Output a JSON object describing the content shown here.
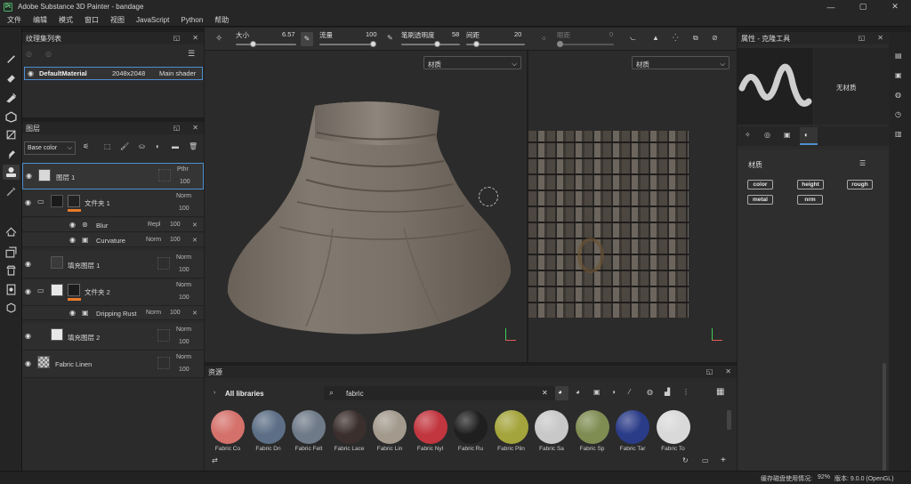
{
  "window": {
    "title": "Adobe Substance 3D Painter - bandage",
    "minimize": "—",
    "maximize": "▢",
    "close": "✕"
  },
  "menu": [
    "文件",
    "编辑",
    "模式",
    "窗口",
    "视图",
    "JavaScript",
    "Python",
    "帮助"
  ],
  "texture_set_list": {
    "title": "纹理集列表",
    "row": {
      "name": "DefaultMaterial",
      "resolution": "2048x2048",
      "shader": "Main shader"
    }
  },
  "layers": {
    "title": "图层",
    "channel": "Base color",
    "items": [
      {
        "name": "图层 1",
        "blend": "Pthr",
        "opacity": "100"
      },
      {
        "name": "文件夹 1",
        "blend": "Norm",
        "opacity": "100"
      },
      {
        "name": "Blur",
        "blend": "Repl",
        "opacity": "100"
      },
      {
        "name": "Curvature",
        "blend": "Norm",
        "opacity": "100"
      },
      {
        "name": "填充图层 1",
        "blend": "Norm",
        "opacity": "100"
      },
      {
        "name": "文件夹 2",
        "blend": "Norm",
        "opacity": "100"
      },
      {
        "name": "Dripping Rust",
        "blend": "Norm",
        "opacity": "100"
      },
      {
        "name": "填充图层 2",
        "blend": "Norm",
        "opacity": "100"
      },
      {
        "name": "Fabric Linen",
        "blend": "Norm",
        "opacity": "100"
      }
    ]
  },
  "context_toolbar": {
    "size_label": "大小",
    "size_value": "6.57",
    "flow_label": "流量",
    "flow_value": "100",
    "stroke_opacity_label": "笔刷透明度",
    "stroke_opacity_value": "58",
    "spacing_label": "间距",
    "spacing_value": "20",
    "jitter_label": "眼距",
    "jitter_value": "0"
  },
  "viewport": {
    "left_mode": "材质",
    "right_mode": "材质"
  },
  "properties": {
    "title": "属性 - 克隆工具",
    "no_material": "无材质",
    "section": "材质",
    "channels": [
      "color",
      "height",
      "rough",
      "metal",
      "nrm"
    ]
  },
  "assets": {
    "title": "资源",
    "library": "All libraries",
    "search": "fabric",
    "items": [
      {
        "label": "Fabric Co",
        "color": "#d5716b"
      },
      {
        "label": "Fabric Dn",
        "color": "#5d6f86"
      },
      {
        "label": "Fabric Felt",
        "color": "#6f7a88"
      },
      {
        "label": "Fabric Lace",
        "color": "#3b2f2d"
      },
      {
        "label": "Fabric Lin",
        "color": "#a39a8d"
      },
      {
        "label": "Fabric Nyl",
        "color": "#c2363f"
      },
      {
        "label": "Fabric Ru",
        "color": "#1f1f1f"
      },
      {
        "label": "Fabric Plin",
        "color": "#a4a43c"
      },
      {
        "label": "Fabric Sa",
        "color": "#c8c8c8"
      },
      {
        "label": "Fabric Sp",
        "color": "#7f8c52"
      },
      {
        "label": "Fabric Tar",
        "color": "#2a3b88"
      },
      {
        "label": "Fabric To",
        "color": "#d9d9d9"
      }
    ]
  },
  "status": {
    "cache_label": "缓存磁盘使用情况: ",
    "cache_value": "92%",
    "version": "版本: 9.0.0 (OpenGL)"
  },
  "colors": {
    "accent": "#4d8fd0",
    "folder_orange": "#e87a2a"
  }
}
